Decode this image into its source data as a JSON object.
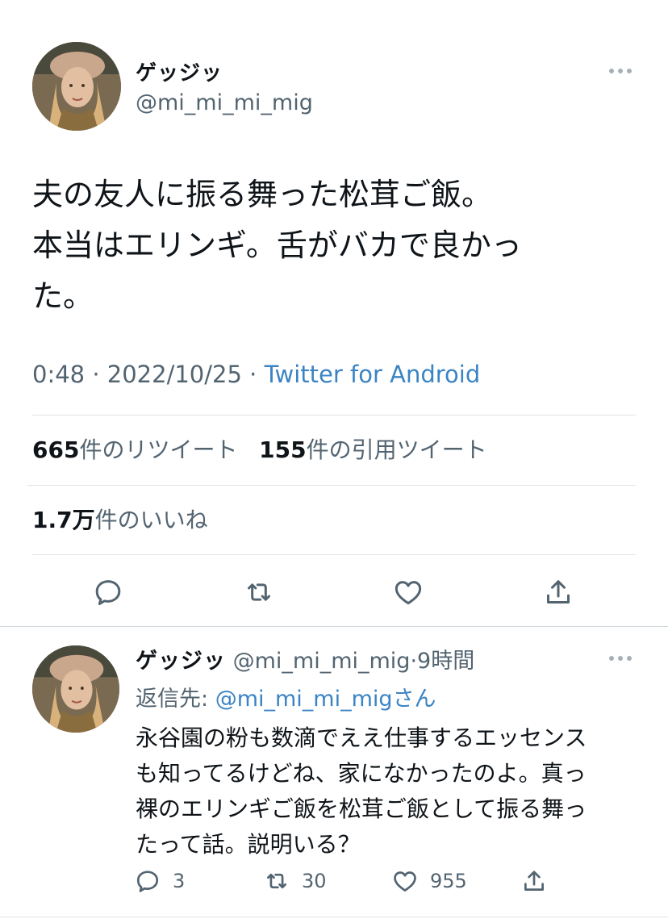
{
  "tweet": {
    "author_name": "ゲッジッ",
    "author_handle": "@mi_mi_mi_mig",
    "text": "夫の友人に振る舞った松茸ご飯。\n本当はエリンギ。舌がバカで良かっ\nた。",
    "time": "0:48",
    "date": "2022/10/25",
    "separator": "·",
    "client": "Twitter for Android"
  },
  "stats": {
    "retweets_count": "665",
    "retweets_label": "件のリツイート",
    "quotes_count": "155",
    "quotes_label": "件の引用ツイート",
    "likes_count": "1.7万",
    "likes_label": "件のいいね"
  },
  "actions": {
    "reply_icon": "reply-icon",
    "retweet_icon": "retweet-icon",
    "like_icon": "heart-icon",
    "share_icon": "share-icon"
  },
  "reply": {
    "author_name": "ゲッジッ",
    "author_handle": "@mi_mi_mi_mig",
    "separator": "·",
    "time_ago": "9時間",
    "reply_prefix": "返信先:",
    "reply_target": "@mi_mi_mi_mig",
    "reply_suffix": "さん",
    "text": "永谷園の粉も数滴でええ仕事するエッセンス\nも知ってるけどね、家になかったのよ。真っ\n裸のエリンギご飯を松茸ご飯として振る舞っ\nたって話。説明いる？",
    "reply_count": "3",
    "retweet_count": "30",
    "like_count": "955"
  },
  "colors": {
    "text": "#0f1419",
    "secondary": "#536471",
    "link": "#3b84c4",
    "divider": "#dfe3e6"
  }
}
